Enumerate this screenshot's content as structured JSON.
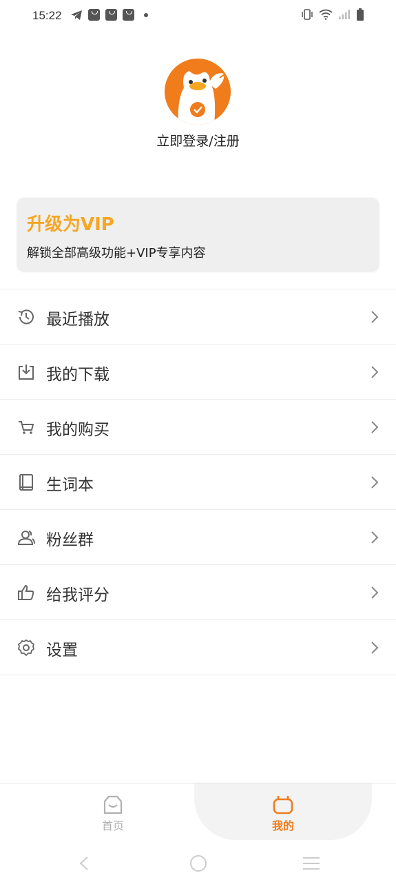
{
  "status_bar": {
    "time": "15:22"
  },
  "profile": {
    "login_text": "立即登录/注册",
    "avatar_colors": {
      "bg": "#f07c1c",
      "mascot": "#ffffff",
      "check": "#f5a623"
    }
  },
  "vip": {
    "title": "升级为VIP",
    "subtitle": "解锁全部高级功能+VIP专享内容",
    "title_color": "#f5a623"
  },
  "menu": {
    "items": [
      {
        "label": "最近播放",
        "icon": "history-icon"
      },
      {
        "label": "我的下载",
        "icon": "download-icon"
      },
      {
        "label": "我的购买",
        "icon": "cart-icon"
      },
      {
        "label": "生词本",
        "icon": "book-icon"
      },
      {
        "label": "粉丝群",
        "icon": "group-icon"
      },
      {
        "label": "给我评分",
        "icon": "thumbs-up-icon"
      },
      {
        "label": "设置",
        "icon": "gear-icon"
      }
    ]
  },
  "tabs": {
    "home": {
      "label": "首页",
      "icon": "home-icon",
      "color": "#b0b0b0"
    },
    "mine": {
      "label": "我的",
      "icon": "mine-icon",
      "color": "#f07c1c",
      "active": true
    }
  }
}
